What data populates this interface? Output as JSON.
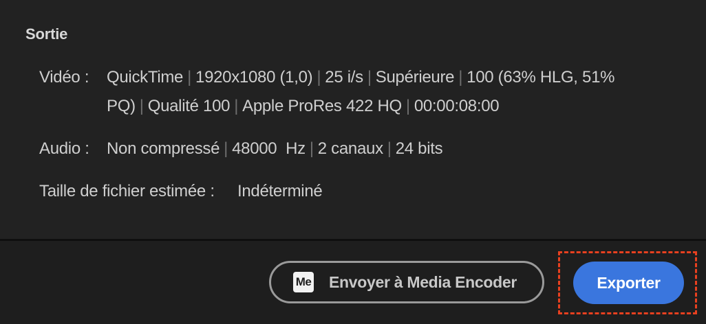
{
  "output": {
    "title": "Sortie",
    "video": {
      "label": "Vidéo :",
      "line1": [
        "QuickTime",
        "1920x1080 (1,0)",
        "25 i/s",
        "Supérieure",
        "100 (63% HLG, 51%"
      ],
      "line2": [
        "PQ)",
        "Qualité 100",
        "Apple ProRes 422 HQ",
        "00:00:08:00"
      ]
    },
    "audio": {
      "label": "Audio :",
      "parts": [
        "Non compressé",
        "48000  Hz",
        "2 canaux",
        "24 bits"
      ]
    },
    "filesize": {
      "label": "Taille de fichier estimée :",
      "value": "Indéterminé"
    }
  },
  "footer": {
    "media_encoder_icon_text": "Me",
    "media_encoder_label": "Envoyer à Media Encoder",
    "export_label": "Exporter"
  },
  "colors": {
    "accent": "#3a76de",
    "highlight": "#e8401f",
    "background": "#1e1e1e"
  }
}
